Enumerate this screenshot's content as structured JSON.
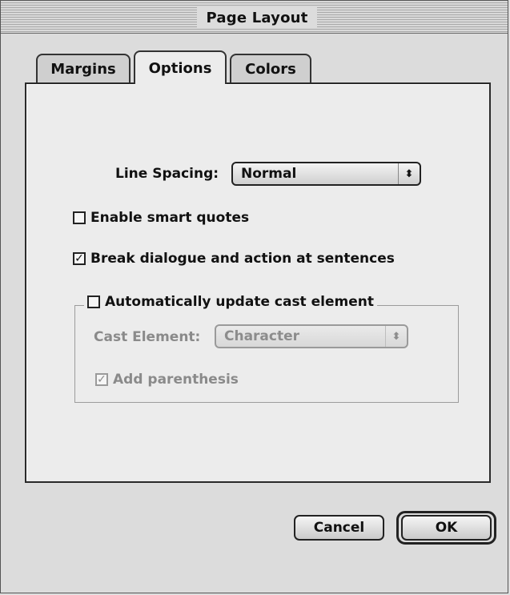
{
  "window": {
    "title": "Page Layout"
  },
  "tabs": [
    {
      "label": "Margins",
      "selected": false
    },
    {
      "label": "Options",
      "selected": true
    },
    {
      "label": "Colors",
      "selected": false
    }
  ],
  "options": {
    "line_spacing": {
      "label": "Line Spacing:",
      "value": "Normal"
    },
    "smart_quotes": {
      "label": "Enable smart quotes",
      "checked": false
    },
    "break_dialogue": {
      "label": "Break dialogue and action at sentences",
      "checked": true
    },
    "auto_update_cast": {
      "label": "Automatically update cast element",
      "checked": false,
      "cast_element": {
        "label": "Cast Element:",
        "value": "Character",
        "enabled": false
      },
      "add_parenthesis": {
        "label": "Add parenthesis",
        "checked": true,
        "enabled": false
      }
    }
  },
  "buttons": {
    "cancel": "Cancel",
    "ok": "OK"
  },
  "icons": {
    "popup_arrows": "updown-arrows-icon",
    "checkmark": "checkmark-icon"
  }
}
